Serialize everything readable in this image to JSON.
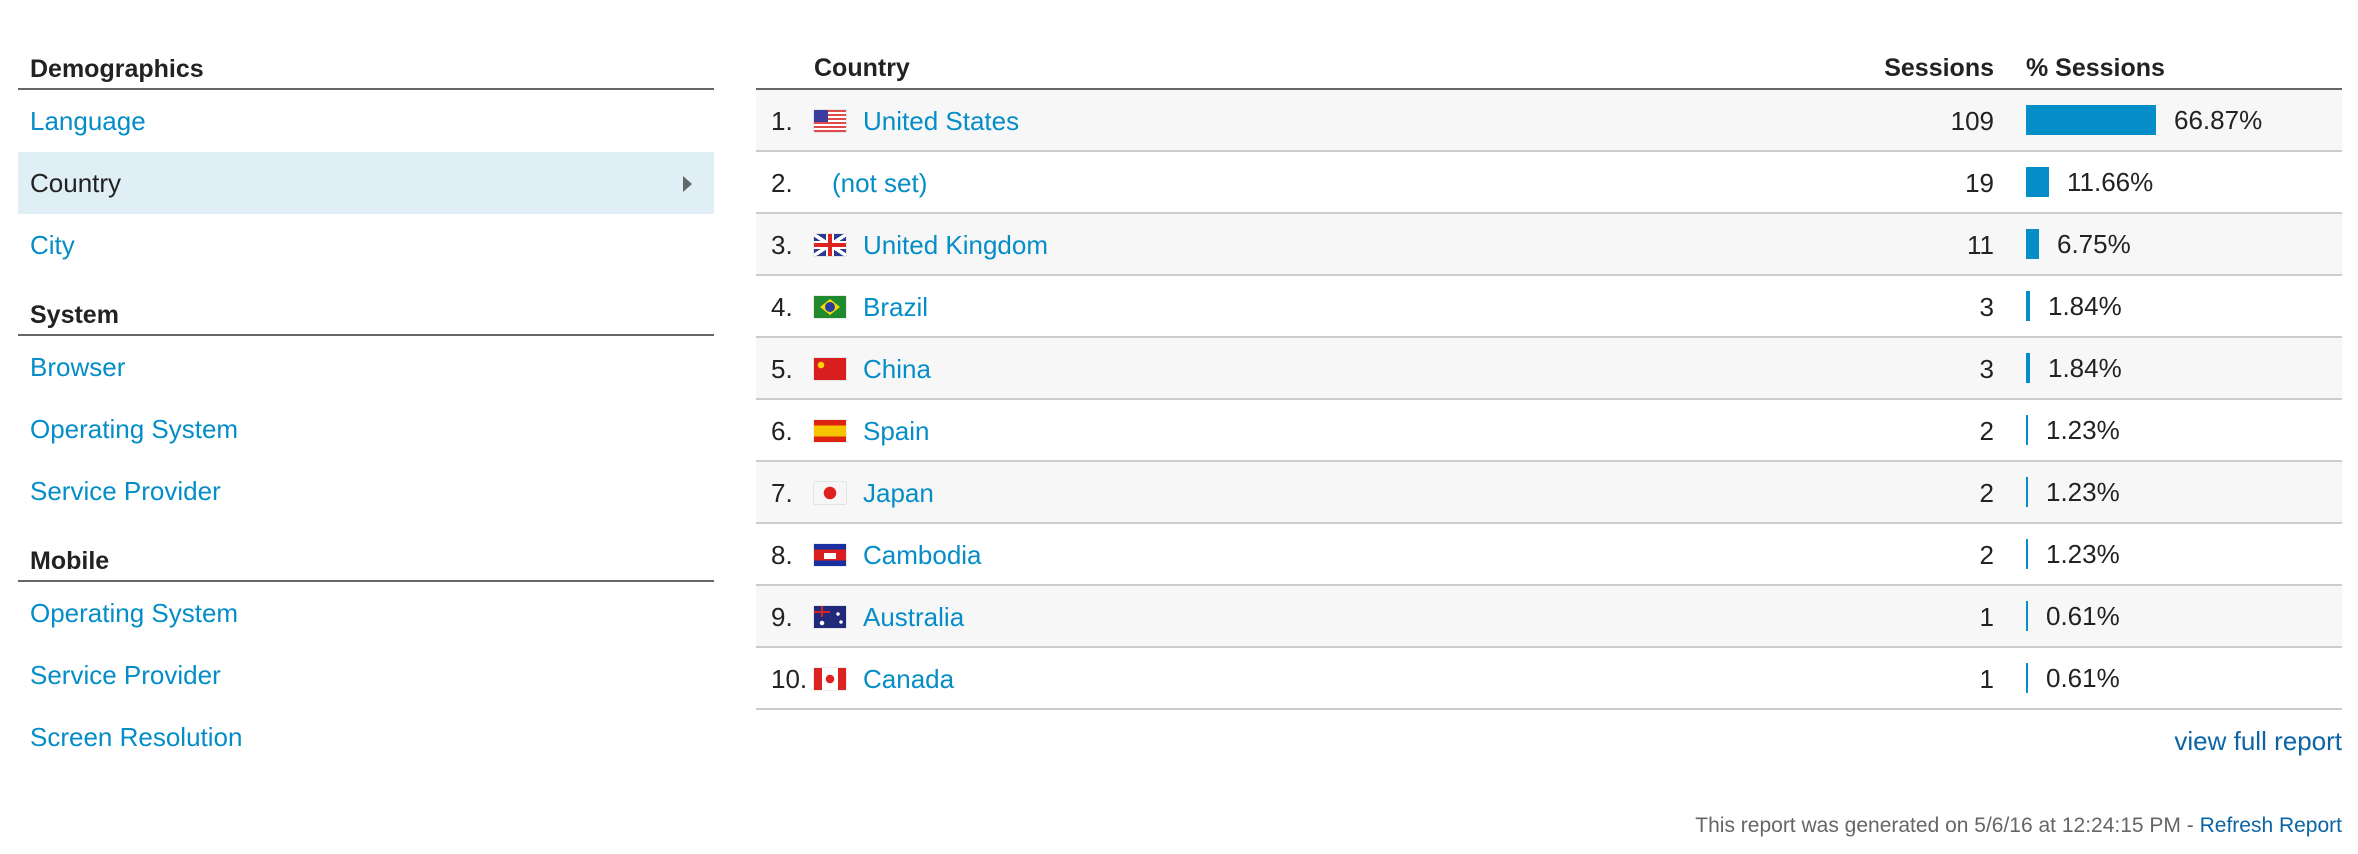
{
  "nav": {
    "sections": [
      {
        "title": "Demographics",
        "items": [
          {
            "label": "Language",
            "selected": false
          },
          {
            "label": "Country",
            "selected": true
          },
          {
            "label": "City",
            "selected": false
          }
        ]
      },
      {
        "title": "System",
        "items": [
          {
            "label": "Browser",
            "selected": false
          },
          {
            "label": "Operating System",
            "selected": false
          },
          {
            "label": "Service Provider",
            "selected": false
          }
        ]
      },
      {
        "title": "Mobile",
        "items": [
          {
            "label": "Operating System",
            "selected": false
          },
          {
            "label": "Service Provider",
            "selected": false
          },
          {
            "label": "Screen Resolution",
            "selected": false
          }
        ]
      }
    ],
    "selected_indicator_icon": "triangle-right-icon"
  },
  "table": {
    "headers": {
      "country": "Country",
      "sessions": "Sessions",
      "pct_sessions": "% Sessions"
    },
    "rows": [
      {
        "rank": "1.",
        "flag": "us-flag-icon",
        "country": "United States",
        "sessions": "109",
        "pct": "66.87%",
        "pct_value": 66.87
      },
      {
        "rank": "2.",
        "flag": null,
        "country": "(not set)",
        "sessions": "19",
        "pct": "11.66%",
        "pct_value": 11.66
      },
      {
        "rank": "3.",
        "flag": "gb-flag-icon",
        "country": "United Kingdom",
        "sessions": "11",
        "pct": "6.75%",
        "pct_value": 6.75
      },
      {
        "rank": "4.",
        "flag": "br-flag-icon",
        "country": "Brazil",
        "sessions": "3",
        "pct": "1.84%",
        "pct_value": 1.84
      },
      {
        "rank": "5.",
        "flag": "cn-flag-icon",
        "country": "China",
        "sessions": "3",
        "pct": "1.84%",
        "pct_value": 1.84
      },
      {
        "rank": "6.",
        "flag": "es-flag-icon",
        "country": "Spain",
        "sessions": "2",
        "pct": "1.23%",
        "pct_value": 1.23
      },
      {
        "rank": "7.",
        "flag": "jp-flag-icon",
        "country": "Japan",
        "sessions": "2",
        "pct": "1.23%",
        "pct_value": 1.23
      },
      {
        "rank": "8.",
        "flag": "kh-flag-icon",
        "country": "Cambodia",
        "sessions": "2",
        "pct": "1.23%",
        "pct_value": 1.23
      },
      {
        "rank": "9.",
        "flag": "au-flag-icon",
        "country": "Australia",
        "sessions": "1",
        "pct": "0.61%",
        "pct_value": 0.61
      },
      {
        "rank": "10.",
        "flag": "ca-flag-icon",
        "country": "Canada",
        "sessions": "1",
        "pct": "0.61%",
        "pct_value": 0.61
      }
    ],
    "bar_color": "#058dc7"
  },
  "links": {
    "view_full_report": "view full report"
  },
  "footer": {
    "generated_text": "This report was generated on 5/6/16 at 12:24:15 PM - ",
    "refresh_label": "Refresh Report"
  },
  "colors": {
    "link": "#058dc7",
    "selected_bg": "#e0eef6",
    "footer_link": "#0b64a4"
  }
}
